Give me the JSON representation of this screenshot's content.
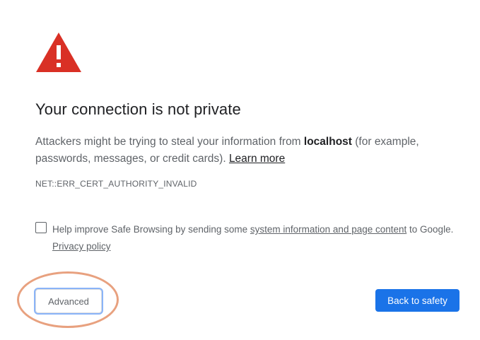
{
  "icon": {
    "name": "warning-triangle-icon",
    "color": "#d93025"
  },
  "title": "Your connection is not private",
  "message": {
    "part1": "Attackers might be trying to steal your information from ",
    "host": "localhost",
    "part2": " (for example, passwords, messages, or credit cards). ",
    "learn_more": "Learn more"
  },
  "error_code": "NET::ERR_CERT_AUTHORITY_INVALID",
  "safe_browsing": {
    "checked": false,
    "text_before": "Help improve Safe Browsing by sending some ",
    "link_text": "system information and page content",
    "text_after": " to Google.",
    "privacy_link": "Privacy policy"
  },
  "buttons": {
    "advanced": "Advanced",
    "back_to_safety": "Back to safety"
  },
  "colors": {
    "primary_button": "#1a73e8",
    "annotation_oval": "#e8a17f"
  }
}
